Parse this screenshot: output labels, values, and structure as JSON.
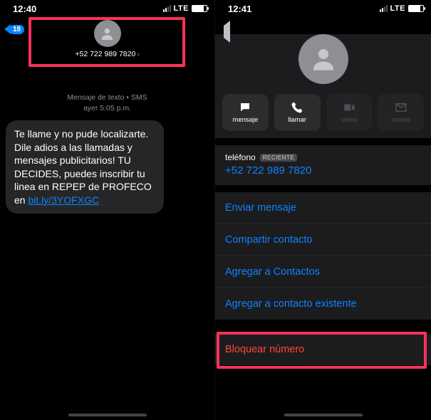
{
  "left": {
    "status": {
      "time": "12:40",
      "net": "LTE"
    },
    "back_badge": "18",
    "contact_number": "+52 722 989 7820",
    "meta_line1": "Mensaje de texto • SMS",
    "meta_line2": "ayer 5:05 p.m.",
    "bubble_pre": "Te llame y no pude localizarte. Dile adios a las llamadas y mensajes publicitarios! TU DECIDES, puedes inscribir tu linea en REPEP de PROFECO en ",
    "bubble_link": "bit.ly/3YOFXGC"
  },
  "right": {
    "status": {
      "time": "12:41",
      "net": "LTE"
    },
    "actions": {
      "message": "mensaje",
      "call": "llamar",
      "video": "video",
      "mail": "correo"
    },
    "phone_label": "teléfono",
    "badge": "RECIENTE",
    "number": "+52 722 989 7820",
    "menu": {
      "send_message": "Enviar mensaje",
      "share_contact": "Compartir contacto",
      "add_contacts": "Agregar a Contactos",
      "add_existing": "Agregar a contacto existente",
      "block": "Bloquear número"
    }
  }
}
